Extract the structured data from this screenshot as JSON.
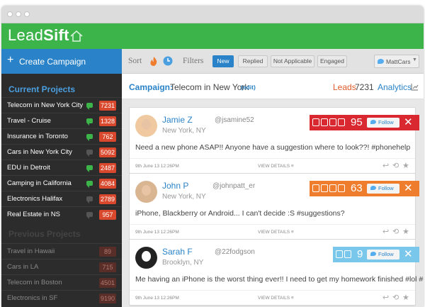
{
  "app": {
    "logo_plain": "Lead",
    "logo_bold": "Sift"
  },
  "sidebar": {
    "create_label": "Create Campaign",
    "current_title": "Current Projects",
    "current_projects": [
      {
        "name": "Telecom in New York City",
        "count": "7231",
        "bubble": "#3cb44a"
      },
      {
        "name": "Travel - Cruise",
        "count": "1328",
        "bubble": "#3cb44a"
      },
      {
        "name": "Insurance in Toronto",
        "count": "762",
        "bubble": "#3cb44a"
      },
      {
        "name": "Cars in New York City",
        "count": "5092",
        "bubble": "#555555"
      },
      {
        "name": "EDU in Detroit",
        "count": "2487",
        "bubble": "#3cb44a"
      },
      {
        "name": "Camping in California",
        "count": "4084",
        "bubble": "#3cb44a"
      },
      {
        "name": "Electronics Halifax",
        "count": "2789",
        "bubble": "#555555"
      },
      {
        "name": "Real Estate in NS",
        "count": "957",
        "bubble": "#555555"
      }
    ],
    "previous_title": "Previous Projects",
    "previous_projects": [
      {
        "name": "Travel in Hawaii",
        "count": "89"
      },
      {
        "name": "Cars in LA",
        "count": "715"
      },
      {
        "name": "Telecom in Boston",
        "count": "4501"
      },
      {
        "name": "Electronics in SF",
        "count": "9190"
      }
    ]
  },
  "toolbar": {
    "sort_label": "Sort",
    "filters_label": "Filters",
    "filters": [
      {
        "label": "New",
        "active": true
      },
      {
        "label": "Replied",
        "active": false
      },
      {
        "label": "Not Applicable",
        "active": false
      },
      {
        "label": "Engaged",
        "active": false
      }
    ],
    "user": "MattCars"
  },
  "campaign": {
    "label": "Campaign:",
    "name": "Telecom in New York",
    "edit": "(edit)",
    "leads_label": "Leads",
    "leads_count": "7231",
    "analytics_label": "Analytics"
  },
  "leads": [
    {
      "name": "Jamie Z",
      "handle": "@jsamine52",
      "location": "New York, NY",
      "text": "Need a new phone ASAP!! Anyone have a suggestion where to look??! #phonehelp",
      "date": "9th June 13 12:26PM",
      "view": "VIEW DETAILS ≡",
      "score": "95",
      "score_color": "#d9282f",
      "follow": "Follow",
      "close": "✕"
    },
    {
      "name": "John P",
      "handle": "@johnpatt_er",
      "location": "New York, NY",
      "text": "iPhone, Blackberry or Android... I can't decide :S #suggestions?",
      "date": "9th June 13 12:26PM",
      "view": "VIEW DETAILS ≡",
      "score": "63",
      "score_color": "#ee7d2e",
      "follow": "Follow",
      "close": "✕"
    },
    {
      "name": "Sarah F",
      "handle": "@22fodgson",
      "location": "Brooklyn, NY",
      "text": "Me having an iPhone is the worst thing ever!! I need to get my homework finished #lol #ugh !!",
      "date": "9th June 13 12:26PM",
      "view": "VIEW DETAILS ≡",
      "score": "9",
      "score_color": "#7ac7ec",
      "follow": "Follow",
      "close": "✕"
    }
  ],
  "colors": {
    "brand_green": "#3cb44a",
    "accent_blue": "#2a83c8",
    "count_red": "#d9482c",
    "sidebar": "#2c2c2c"
  }
}
